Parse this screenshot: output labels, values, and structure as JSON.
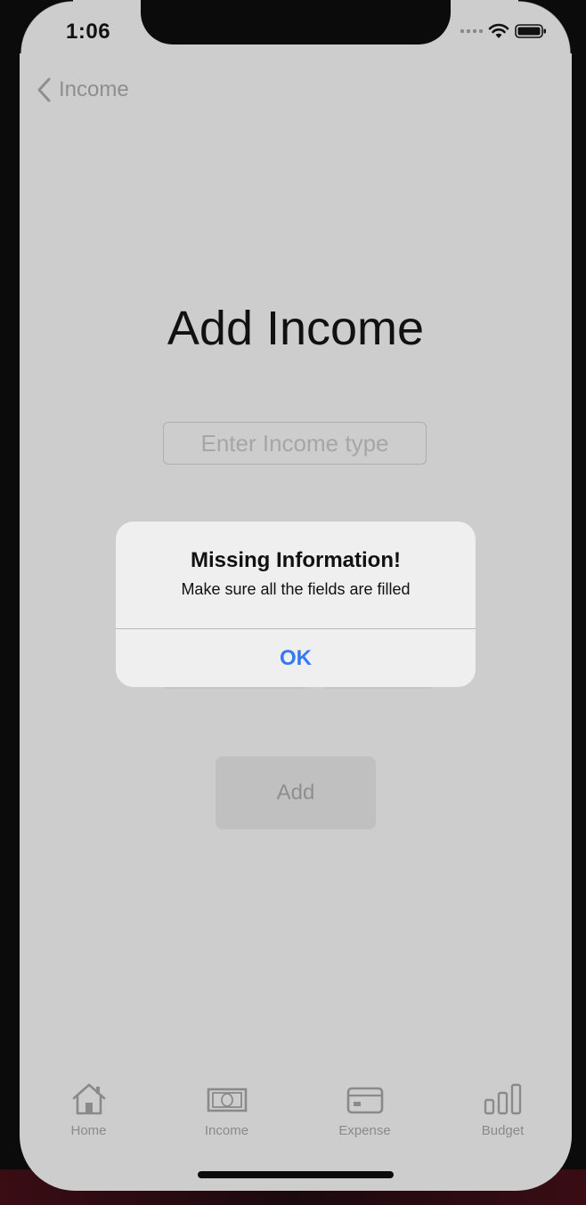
{
  "status_bar": {
    "time": "1:06"
  },
  "nav": {
    "back_label": "Income"
  },
  "page": {
    "title": "Add Income",
    "income_type_placeholder": "Enter Income type",
    "add_button_label": "Add"
  },
  "alert": {
    "title": "Missing Information!",
    "message": "Make sure all the fields are filled",
    "ok_label": "OK"
  },
  "tab_bar": {
    "tabs": [
      {
        "label": "Home",
        "icon": "house-icon"
      },
      {
        "label": "Income",
        "icon": "banknote-icon"
      },
      {
        "label": "Expense",
        "icon": "credit-card-icon"
      },
      {
        "label": "Budget",
        "icon": "bar-chart-icon"
      }
    ]
  },
  "colors": {
    "accent": "#3478f6",
    "screen_bg": "#cdcdcd",
    "alert_bg": "#efefef"
  }
}
